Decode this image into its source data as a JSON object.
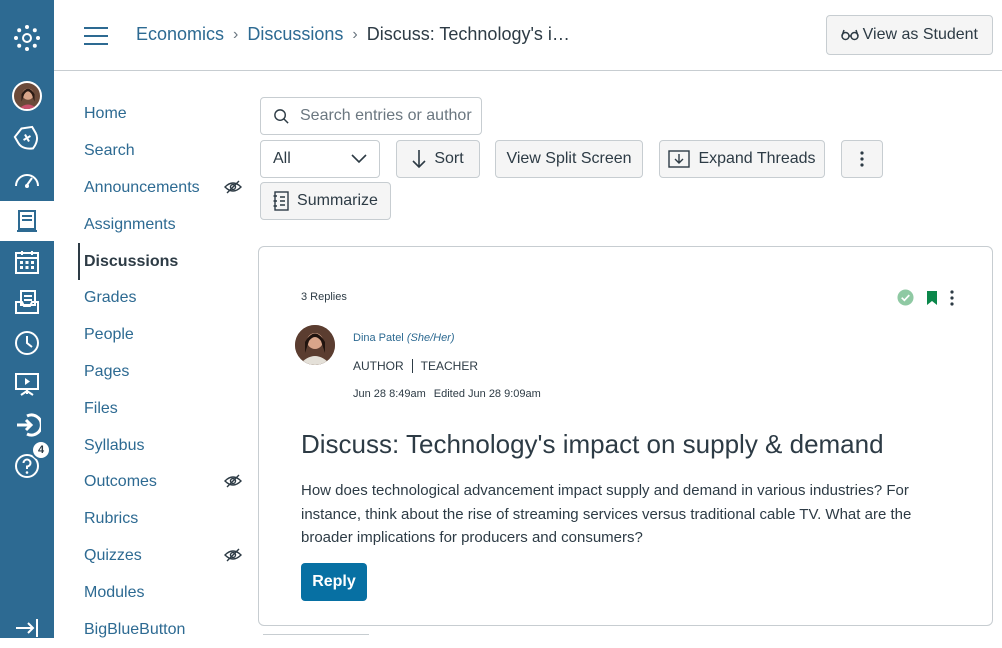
{
  "breadcrumb": {
    "course": "Economics",
    "section": "Discussions",
    "current": "Discuss: Technology's i…"
  },
  "header": {
    "view_as_student": "View as Student"
  },
  "global_nav": {
    "help_badge": "4"
  },
  "course_nav": {
    "items": [
      {
        "label": "Home",
        "hidden": false,
        "active": false
      },
      {
        "label": "Search",
        "hidden": false,
        "active": false
      },
      {
        "label": "Announcements",
        "hidden": true,
        "active": false
      },
      {
        "label": "Assignments",
        "hidden": false,
        "active": false
      },
      {
        "label": "Discussions",
        "hidden": false,
        "active": true
      },
      {
        "label": "Grades",
        "hidden": false,
        "active": false
      },
      {
        "label": "People",
        "hidden": false,
        "active": false
      },
      {
        "label": "Pages",
        "hidden": false,
        "active": false
      },
      {
        "label": "Files",
        "hidden": false,
        "active": false
      },
      {
        "label": "Syllabus",
        "hidden": false,
        "active": false
      },
      {
        "label": "Outcomes",
        "hidden": true,
        "active": false
      },
      {
        "label": "Rubrics",
        "hidden": false,
        "active": false
      },
      {
        "label": "Quizzes",
        "hidden": true,
        "active": false
      },
      {
        "label": "Modules",
        "hidden": false,
        "active": false
      },
      {
        "label": "BigBlueButton",
        "hidden": false,
        "active": false
      }
    ]
  },
  "toolbar": {
    "search_placeholder": "Search entries or author",
    "filter_value": "All",
    "sort_label": "Sort",
    "split_screen_label": "View Split Screen",
    "expand_label": "Expand Threads",
    "summarize_label": "Summarize"
  },
  "discussion": {
    "replies_count": "3 Replies",
    "author": "Dina Patel",
    "pronouns": "(She/Her)",
    "role_1": "AUTHOR",
    "role_2": "TEACHER",
    "posted": "Jun 28 8:49am",
    "edited": "Edited Jun 28 9:09am",
    "title": "Discuss: Technology's impact on supply & demand",
    "body": "How does technological advancement impact supply and demand in various industries? For instance, think about the rise of streaming services versus traditional cable TV. What are the broader implications for producers and consumers?",
    "reply_label": "Reply"
  },
  "colors": {
    "nav_bg": "#2d6a92",
    "link": "#2d6a92",
    "primary_button": "#0770a3",
    "published": "#8fc9a3",
    "bookmark": "#0b874b"
  }
}
